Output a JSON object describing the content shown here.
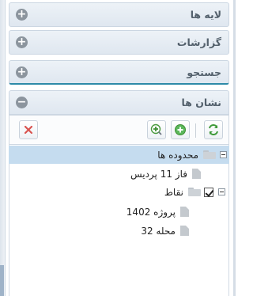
{
  "panels": {
    "layers": {
      "title": "لایه ها",
      "toggle": "+"
    },
    "reports": {
      "title": "گزارشات",
      "toggle": "+"
    },
    "search": {
      "title": "جستجو",
      "toggle": "+"
    },
    "bookmarks": {
      "title": "نشان ها",
      "toggle": "−"
    }
  },
  "toolbar": {
    "delete_icon": "close-icon",
    "add_child_icon": "add-child-icon",
    "add_icon": "add-icon",
    "refresh_icon": "refresh-icon"
  },
  "tree": {
    "regions": {
      "label": "محدوده ها"
    },
    "phase11": {
      "label": "فاز 11 پردیس"
    },
    "points": {
      "label": "نقاط"
    },
    "project1402": {
      "label": "پروژه 1402"
    },
    "area32": {
      "label": "محله 32"
    }
  },
  "colors": {
    "selected_row": "#c5dcef",
    "panel_header": "#dfe7f0",
    "accent_border": "#2d8aa8",
    "delete_red": "#d9534f",
    "add_green": "#4caf50"
  }
}
